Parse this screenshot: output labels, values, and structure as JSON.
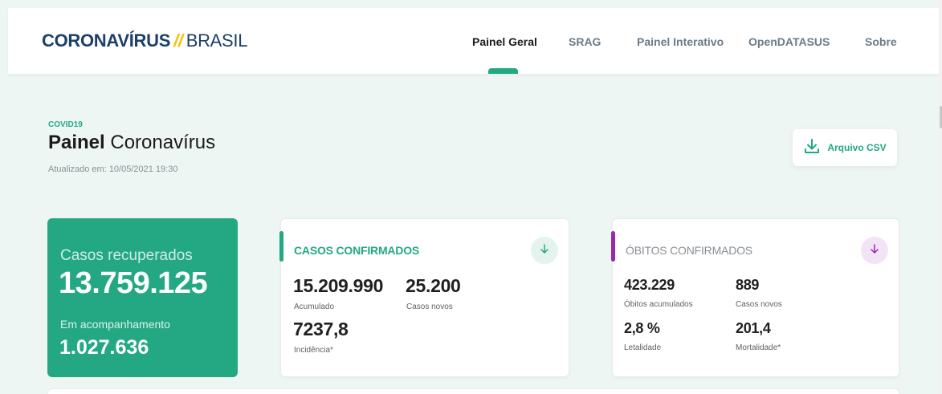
{
  "header": {
    "logo": {
      "bold": "CORONAVÍRUS",
      "slash": "//",
      "light": "BRASIL"
    },
    "nav": [
      {
        "label": "Painel Geral",
        "active": true
      },
      {
        "label": "SRAG",
        "active": false
      },
      {
        "label": "Painel Interativo",
        "active": false
      },
      {
        "label": "OpenDATASUS",
        "active": false
      },
      {
        "label": "Sobre",
        "active": false
      }
    ]
  },
  "page": {
    "eyebrow": "COVID19",
    "title_bold": "Painel",
    "title_light": "Coronavírus",
    "updated": "Atualizado em: 10/05/2021 19:30",
    "csv_button": {
      "label": "Arquivo CSV",
      "icon": "download-icon"
    }
  },
  "recuperados": {
    "label": "Casos recuperados",
    "value": "13.759.125",
    "sub_label": "Em acompanhamento",
    "sub_value": "1.027.636"
  },
  "casos": {
    "heading": "CASOS CONFIRMADOS",
    "accent_color": "#23a883",
    "icon": "arrow-down-icon",
    "stats": [
      {
        "value": "15.209.990",
        "label": "Acumulado"
      },
      {
        "value": "25.200",
        "label": "Casos novos"
      },
      {
        "value": "7237,8",
        "label": "Incidência*"
      }
    ]
  },
  "obitos": {
    "heading": "ÓBITOS CONFIRMADOS",
    "accent_color": "#9b27b0",
    "icon": "arrow-down-icon",
    "stats": [
      {
        "value": "423.229",
        "label": "Óbitos acumulados"
      },
      {
        "value": "889",
        "label": "Casos novos"
      },
      {
        "value": "2,8 %",
        "label": "Letalidade"
      },
      {
        "value": "201,4",
        "label": "Mortalidade*"
      }
    ]
  },
  "colors": {
    "brand_green": "#23a883",
    "brand_navy": "#1d3f6b",
    "brand_yellow": "#f6c300",
    "obitos_purple": "#9b27b0",
    "background": "#eef6f4"
  }
}
